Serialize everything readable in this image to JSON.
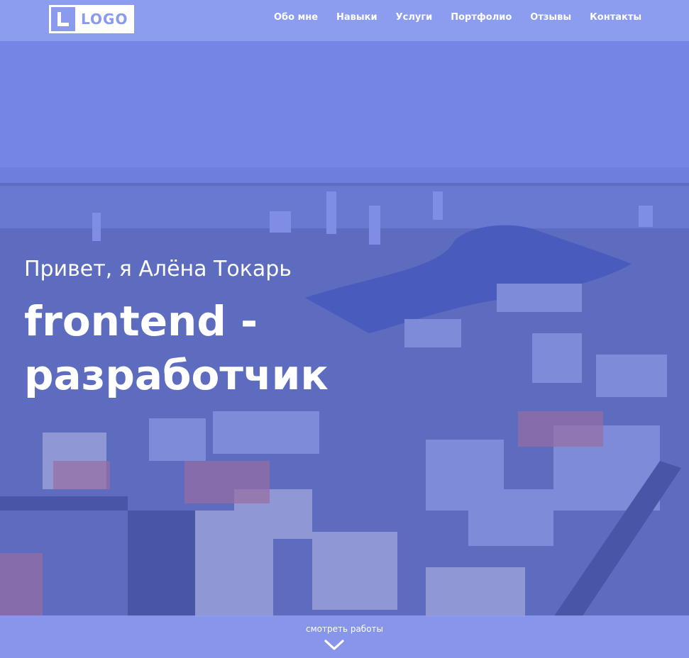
{
  "header": {
    "logo_text": "LOGO",
    "nav": [
      "Обо мне",
      "Навыки",
      "Услуги",
      "Портфолио",
      "Отзывы",
      "Контакты"
    ]
  },
  "hero": {
    "greeting": "Привет, я Алёна Токарь",
    "headline": "frontend - разработчик"
  },
  "footer_cta": {
    "label": "смотреть работы",
    "icon": "chevron-down-icon"
  },
  "colors": {
    "overlay": "#8a9aee",
    "text": "#ffffff"
  }
}
